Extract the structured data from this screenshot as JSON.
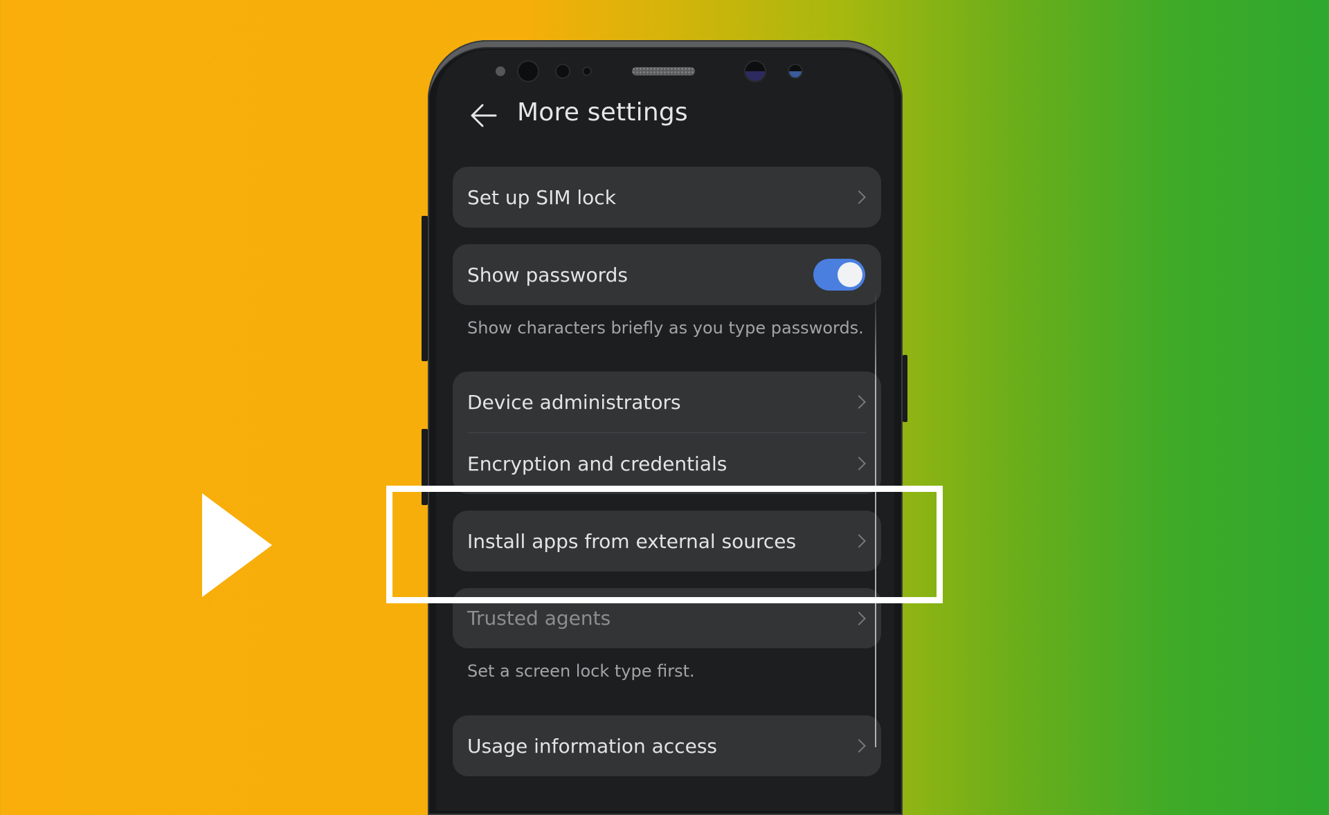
{
  "overlay": {
    "play_icon": "play-icon",
    "highlight_target": "Install apps from external sources"
  },
  "colors": {
    "bg_left": "#f9ae0b",
    "bg_right": "#2ea82e",
    "toggle_on": "#4a7fe0",
    "card": "#323436",
    "screen": "#1c1e20"
  },
  "header": {
    "back_icon": "arrow-left-icon",
    "title": "More settings"
  },
  "items": [
    {
      "label": "Set up SIM lock",
      "control": "chevron"
    },
    {
      "label": "Show passwords",
      "control": "toggle",
      "toggle_on": true,
      "description": "Show characters briefly as you type passwords."
    },
    {
      "label": "Device administrators",
      "control": "chevron"
    },
    {
      "label": "Encryption and credentials",
      "control": "chevron"
    },
    {
      "label": "Install apps from external sources",
      "control": "chevron",
      "highlighted": true
    },
    {
      "label": "Trusted agents",
      "control": "chevron",
      "disabled": true,
      "description": "Set a screen lock type first."
    },
    {
      "label": "Usage information access",
      "control": "chevron"
    }
  ]
}
